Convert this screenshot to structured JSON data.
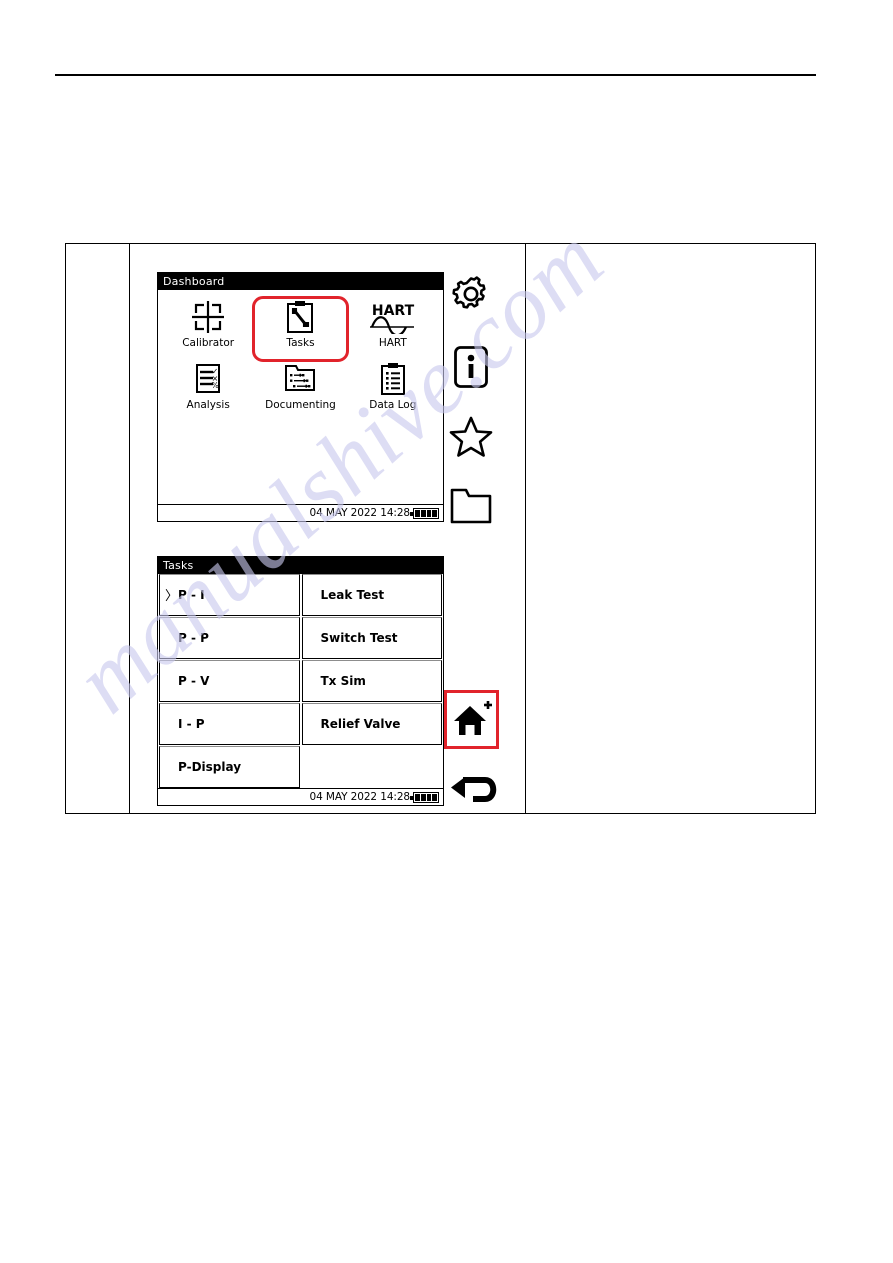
{
  "page": {
    "watermark": "manualshive.com",
    "has_top_rule": true
  },
  "dashboard_screen": {
    "title": "Dashboard",
    "tiles": [
      {
        "label": "Calibrator",
        "icon": "calibrator-crosshair-icon",
        "selected": false
      },
      {
        "label": "Tasks",
        "icon": "clipboard-wrench-icon",
        "selected": true
      },
      {
        "label": "HART",
        "icon": "hart-wave-icon",
        "selected": false
      },
      {
        "label": "Analysis",
        "icon": "analysis-checklist-icon",
        "selected": false
      },
      {
        "label": "Documenting",
        "icon": "folder-arrows-icon",
        "selected": false
      },
      {
        "label": "Data Log",
        "icon": "clipboard-lines-icon",
        "selected": false
      }
    ],
    "status": {
      "datetime": "04 MAY 2022 14:28",
      "battery_bars": 4,
      "battery_icon": "battery-full-icon"
    }
  },
  "tasks_screen": {
    "title": "Tasks",
    "items": [
      {
        "label": "P - I",
        "selected": true,
        "caret": "〉"
      },
      {
        "label": "Leak Test",
        "selected": false,
        "caret": ""
      },
      {
        "label": "P - P",
        "selected": false,
        "caret": ""
      },
      {
        "label": "Switch Test",
        "selected": false,
        "caret": ""
      },
      {
        "label": "P - V",
        "selected": false,
        "caret": ""
      },
      {
        "label": "Tx Sim",
        "selected": false,
        "caret": ""
      },
      {
        "label": "I - P",
        "selected": false,
        "caret": ""
      },
      {
        "label": "Relief Valve",
        "selected": false,
        "caret": ""
      },
      {
        "label": "P-Display",
        "selected": false,
        "caret": ""
      },
      {
        "label": "",
        "selected": false,
        "caret": ""
      }
    ],
    "status": {
      "datetime": "04 MAY 2022 14:28",
      "battery_bars": 4,
      "battery_icon": "battery-full-icon"
    }
  },
  "icon_rail_top": [
    {
      "name": "gear-icon"
    },
    {
      "name": "info-icon"
    },
    {
      "name": "star-icon"
    },
    {
      "name": "folder-icon"
    }
  ],
  "icon_rail_bottom": [
    {
      "name": "home-plus-icon",
      "highlighted": true
    },
    {
      "name": "back-arrow-icon",
      "highlighted": false
    }
  ],
  "colors": {
    "highlight": "#e1232b",
    "screen_bg": "#ffffff",
    "title_bar": "#000000",
    "watermark": "#c9c9ee"
  }
}
